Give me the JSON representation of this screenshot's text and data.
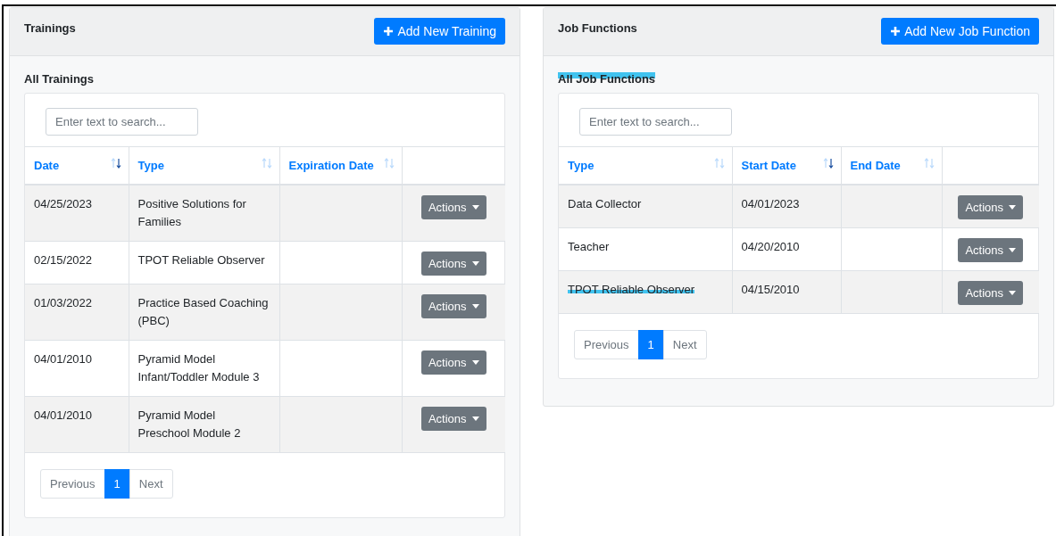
{
  "panels": [
    {
      "title": "Trainings",
      "add_button": "Add New Training",
      "list_title": {
        "text": "All Trainings",
        "highlighted": false
      },
      "search": {
        "placeholder": "Enter text to search..."
      },
      "table": {
        "columns": [
          {
            "label": "Date",
            "sorted": true
          },
          {
            "label": "Type",
            "sorted": false
          },
          {
            "label": "Expiration Date",
            "sorted": false
          }
        ],
        "rows": [
          {
            "cells": [
              {
                "text": "04/25/2023",
                "highlighted": false
              },
              {
                "text": "Positive Solutions for Families",
                "highlighted": false
              }
            ],
            "action": "Actions"
          },
          {
            "cells": [
              {
                "text": "02/15/2022",
                "highlighted": false
              },
              {
                "text": "TPOT Reliable Observer",
                "highlighted": false
              }
            ],
            "action": "Actions"
          },
          {
            "cells": [
              {
                "text": "01/03/2022",
                "highlighted": false
              },
              {
                "text": "Practice Based Coaching (PBC)",
                "highlighted": false
              }
            ],
            "action": "Actions"
          },
          {
            "cells": [
              {
                "text": "04/01/2010",
                "highlighted": false
              },
              {
                "text": "Pyramid Model Infant/Toddler Module 3",
                "highlighted": false
              }
            ],
            "action": "Actions"
          },
          {
            "cells": [
              {
                "text": "04/01/2010",
                "highlighted": false
              },
              {
                "text": "Pyramid Model Preschool Module 2",
                "highlighted": false
              }
            ],
            "action": "Actions"
          }
        ]
      },
      "pagination": {
        "previous": "Previous",
        "pages": [
          {
            "label": "1",
            "selected": true
          }
        ],
        "next": "Next"
      }
    },
    {
      "title": "Job Functions",
      "add_button": "Add New Job Function",
      "list_title": {
        "text": "All Job Functions",
        "highlighted": true
      },
      "search": {
        "placeholder": "Enter text to search..."
      },
      "table": {
        "columns": [
          {
            "label": "Type",
            "sorted": false
          },
          {
            "label": "Start Date",
            "sorted": true
          },
          {
            "label": "End Date",
            "sorted": false
          }
        ],
        "rows": [
          {
            "cells": [
              {
                "text": "Data Collector",
                "highlighted": false
              },
              {
                "text": "04/01/2023",
                "highlighted": false
              }
            ],
            "action": "Actions"
          },
          {
            "cells": [
              {
                "text": "Teacher",
                "highlighted": false
              },
              {
                "text": "04/20/2010",
                "highlighted": false
              }
            ],
            "action": "Actions"
          },
          {
            "cells": [
              {
                "text": "TPOT Reliable Observer",
                "highlighted": true
              },
              {
                "text": "04/15/2010",
                "highlighted": false
              }
            ],
            "action": "Actions"
          }
        ]
      },
      "pagination": {
        "previous": "Previous",
        "pages": [
          {
            "label": "1",
            "selected": true
          }
        ],
        "next": "Next"
      }
    }
  ]
}
